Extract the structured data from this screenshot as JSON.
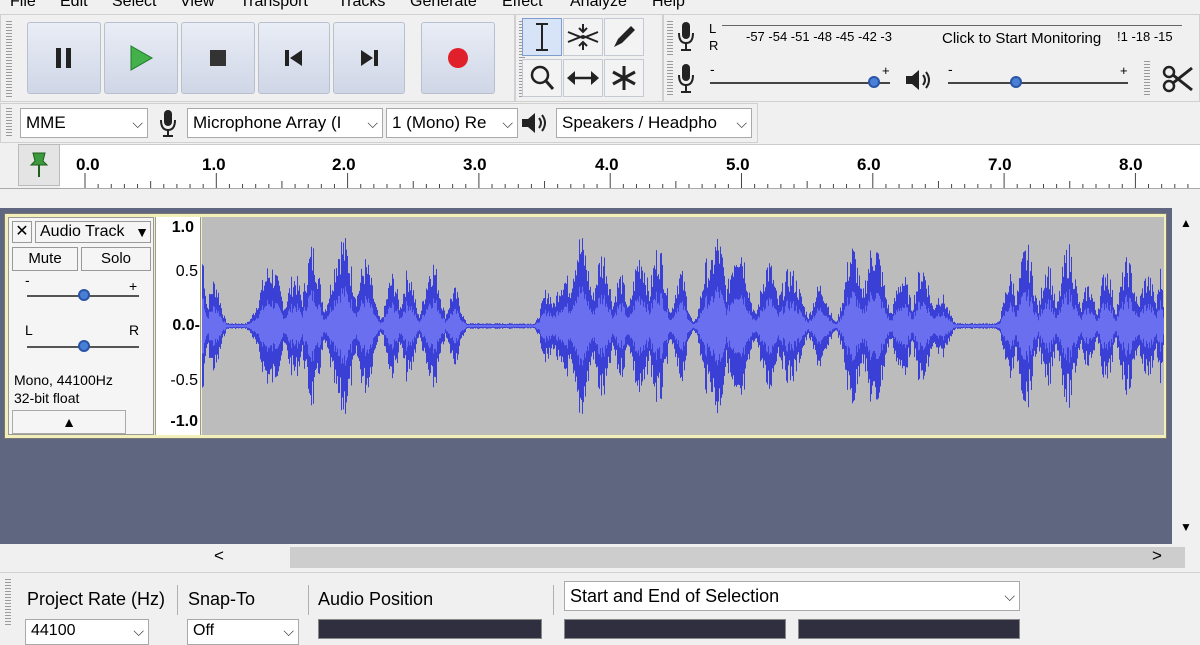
{
  "menu": [
    "File",
    "Edit",
    "Select",
    "View",
    "Transport",
    "Tracks",
    "Generate",
    "Effect",
    "Analyze",
    "Help"
  ],
  "transport": {
    "pause_icon": "pause-icon",
    "play_icon": "play-icon",
    "stop_icon": "stop-icon",
    "skip_start_icon": "skip-to-start-icon",
    "skip_end_icon": "skip-to-end-icon",
    "record_icon": "record-icon",
    "play_color": "#2ea043",
    "record_color": "#e0202a"
  },
  "meter": {
    "rec_channels": [
      "L",
      "R"
    ],
    "scale": "-57 -54 -51 -48 -45 -42 -3",
    "monitor_text": "Click to Start Monitoring",
    "scale_tail": "!1 -18 -15"
  },
  "sliders": {
    "minus": "-",
    "plus": "+"
  },
  "device": {
    "host": "MME",
    "input": "Microphone Array (I",
    "channels": "1 (Mono) Re",
    "output": "Speakers / Headpho"
  },
  "ruler": {
    "labels": [
      "0.0",
      "1.0",
      "2.0",
      "3.0",
      "4.0",
      "5.0",
      "6.0",
      "7.0",
      "8.0"
    ]
  },
  "track": {
    "name": "Audio Track",
    "mute": "Mute",
    "solo": "Solo",
    "gain_minus": "-",
    "gain_plus": "+",
    "pan_left": "L",
    "pan_right": "R",
    "info_line1": "Mono, 44100Hz",
    "info_line2": "32-bit float",
    "scale": [
      "1.0",
      "0.5",
      "0.0-",
      "-0.5",
      "-1.0"
    ],
    "wave_color": "#3a3fd6"
  },
  "scroll": {
    "left": "<",
    "right": ">"
  },
  "selection": {
    "project_rate_label": "Project Rate (Hz)",
    "project_rate_value": "44100",
    "snap_label": "Snap-To",
    "snap_value": "Off",
    "audio_position_label": "Audio Position",
    "selection_mode": "Start and End of Selection"
  }
}
